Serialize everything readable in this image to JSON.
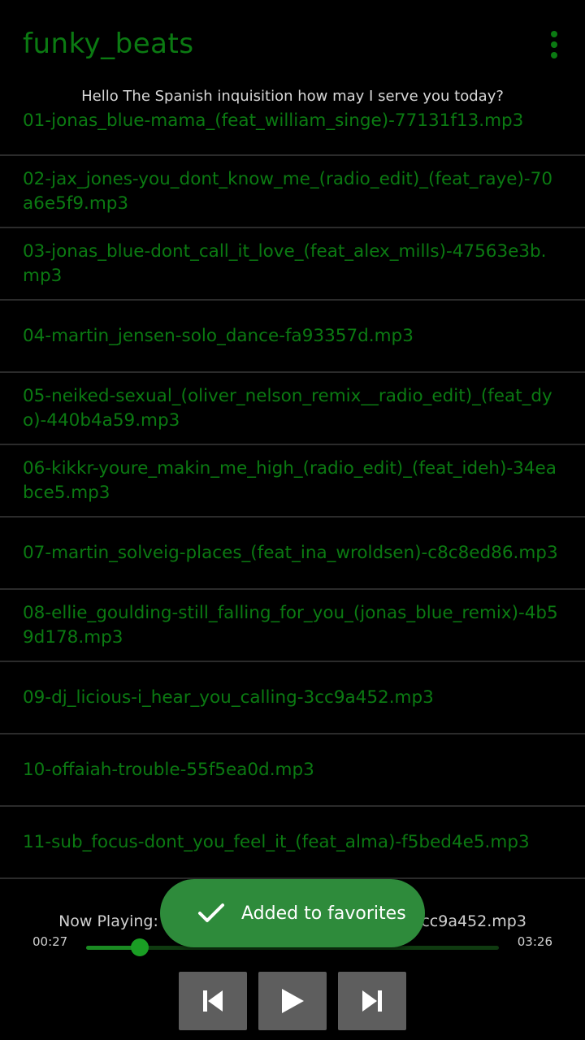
{
  "app": {
    "title": "funky_beats",
    "greeting": "Hello The Spanish inquisition how may I serve you today?"
  },
  "colors": {
    "accent": "#0b7a12",
    "background": "#000000",
    "toast": "#2e8b3b",
    "divider": "#2b2b2b"
  },
  "songs": [
    "01-jonas_blue-mama_(feat_william_singe)-77131f13.mp3",
    "02-jax_jones-you_dont_know_me_(radio_edit)_(feat_raye)-70a6e5f9.mp3",
    "03-jonas_blue-dont_call_it_love_(feat_alex_mills)-47563e3b.mp3",
    "04-martin_jensen-solo_dance-fa93357d.mp3",
    "05-neiked-sexual_(oliver_nelson_remix__radio_edit)_(feat_dyo)-440b4a59.mp3",
    "06-kikkr-youre_makin_me_high_(radio_edit)_(feat_ideh)-34eabce5.mp3",
    "07-martin_solveig-places_(feat_ina_wroldsen)-c8c8ed86.mp3",
    "08-ellie_goulding-still_falling_for_you_(jonas_blue_remix)-4b59d178.mp3",
    "09-dj_licious-i_hear_you_calling-3cc9a452.mp3",
    "10-offaiah-trouble-55f5ea0d.mp3",
    "11-sub_focus-dont_you_feel_it_(feat_alma)-f5bed4e5.mp3"
  ],
  "player": {
    "now_playing": "Now Playing: 09-dj_licious-i_hear_you_calling-3cc9a452.mp3",
    "current_time": "00:27",
    "total_time": "03:26",
    "progress": 0.13,
    "buttons": [
      "skip-previous-icon",
      "play-icon",
      "skip-next-icon"
    ]
  },
  "toast": {
    "message": "Added to favorites",
    "icon": "checkmark-icon"
  }
}
